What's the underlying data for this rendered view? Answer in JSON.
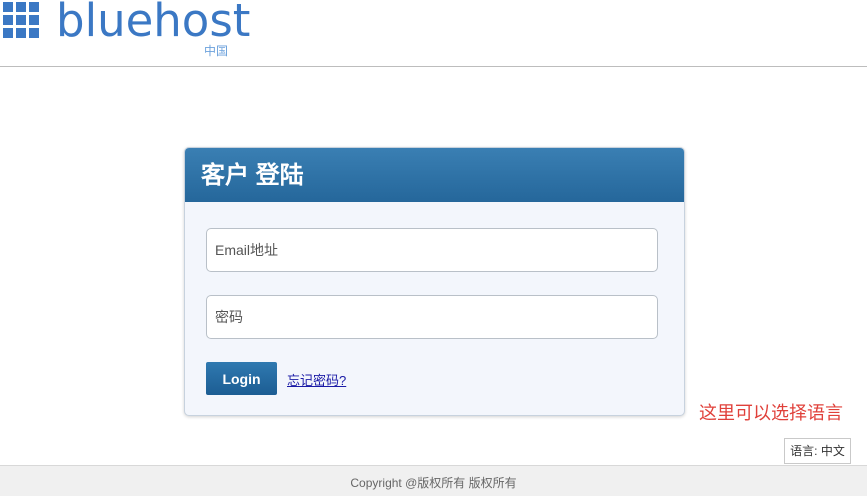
{
  "header": {
    "logo_text": "bluehost",
    "logo_sub": "中国",
    "brand_color": "#3b78c4"
  },
  "login": {
    "title": "客户 登陆",
    "email_placeholder": "Email地址",
    "password_placeholder": "密码",
    "login_label": "Login",
    "forgot_label": "忘记密码?"
  },
  "annotation": {
    "hint": "这里可以选择语言"
  },
  "language": {
    "label": "语言: 中文"
  },
  "footer": {
    "copyright": "Copyright @版权所有 版权所有"
  },
  "colors": {
    "header_blue": "#2f74a9",
    "hint_red": "#e0403a"
  }
}
